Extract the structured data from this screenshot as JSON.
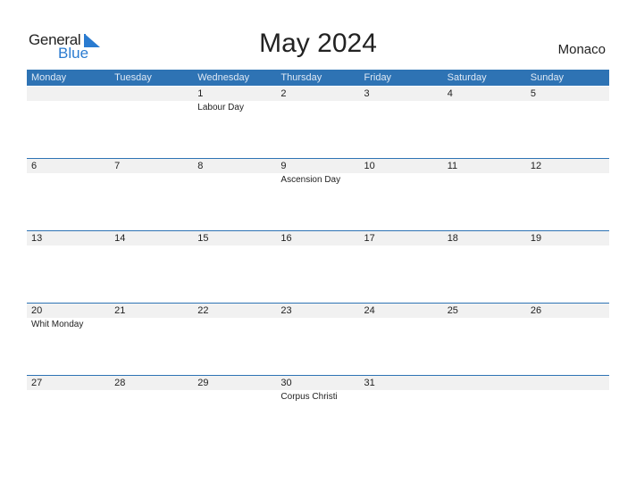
{
  "logo": {
    "word1": "General",
    "word2": "Blue"
  },
  "title": "May 2024",
  "country": "Monaco",
  "weekdays": [
    "Monday",
    "Tuesday",
    "Wednesday",
    "Thursday",
    "Friday",
    "Saturday",
    "Sunday"
  ],
  "weeks": [
    [
      {
        "day": "",
        "holiday": ""
      },
      {
        "day": "",
        "holiday": ""
      },
      {
        "day": "1",
        "holiday": "Labour Day"
      },
      {
        "day": "2",
        "holiday": ""
      },
      {
        "day": "3",
        "holiday": ""
      },
      {
        "day": "4",
        "holiday": ""
      },
      {
        "day": "5",
        "holiday": ""
      }
    ],
    [
      {
        "day": "6",
        "holiday": ""
      },
      {
        "day": "7",
        "holiday": ""
      },
      {
        "day": "8",
        "holiday": ""
      },
      {
        "day": "9",
        "holiday": "Ascension Day"
      },
      {
        "day": "10",
        "holiday": ""
      },
      {
        "day": "11",
        "holiday": ""
      },
      {
        "day": "12",
        "holiday": ""
      }
    ],
    [
      {
        "day": "13",
        "holiday": ""
      },
      {
        "day": "14",
        "holiday": ""
      },
      {
        "day": "15",
        "holiday": ""
      },
      {
        "day": "16",
        "holiday": ""
      },
      {
        "day": "17",
        "holiday": ""
      },
      {
        "day": "18",
        "holiday": ""
      },
      {
        "day": "19",
        "holiday": ""
      }
    ],
    [
      {
        "day": "20",
        "holiday": "Whit Monday"
      },
      {
        "day": "21",
        "holiday": ""
      },
      {
        "day": "22",
        "holiday": ""
      },
      {
        "day": "23",
        "holiday": ""
      },
      {
        "day": "24",
        "holiday": ""
      },
      {
        "day": "25",
        "holiday": ""
      },
      {
        "day": "26",
        "holiday": ""
      }
    ],
    [
      {
        "day": "27",
        "holiday": ""
      },
      {
        "day": "28",
        "holiday": ""
      },
      {
        "day": "29",
        "holiday": ""
      },
      {
        "day": "30",
        "holiday": "Corpus Christi"
      },
      {
        "day": "31",
        "holiday": ""
      },
      {
        "day": "",
        "holiday": ""
      },
      {
        "day": "",
        "holiday": ""
      }
    ]
  ],
  "colors": {
    "accent": "#2e73b4",
    "logo_blue": "#2a7bd0",
    "day_strip": "#f1f1f1"
  }
}
